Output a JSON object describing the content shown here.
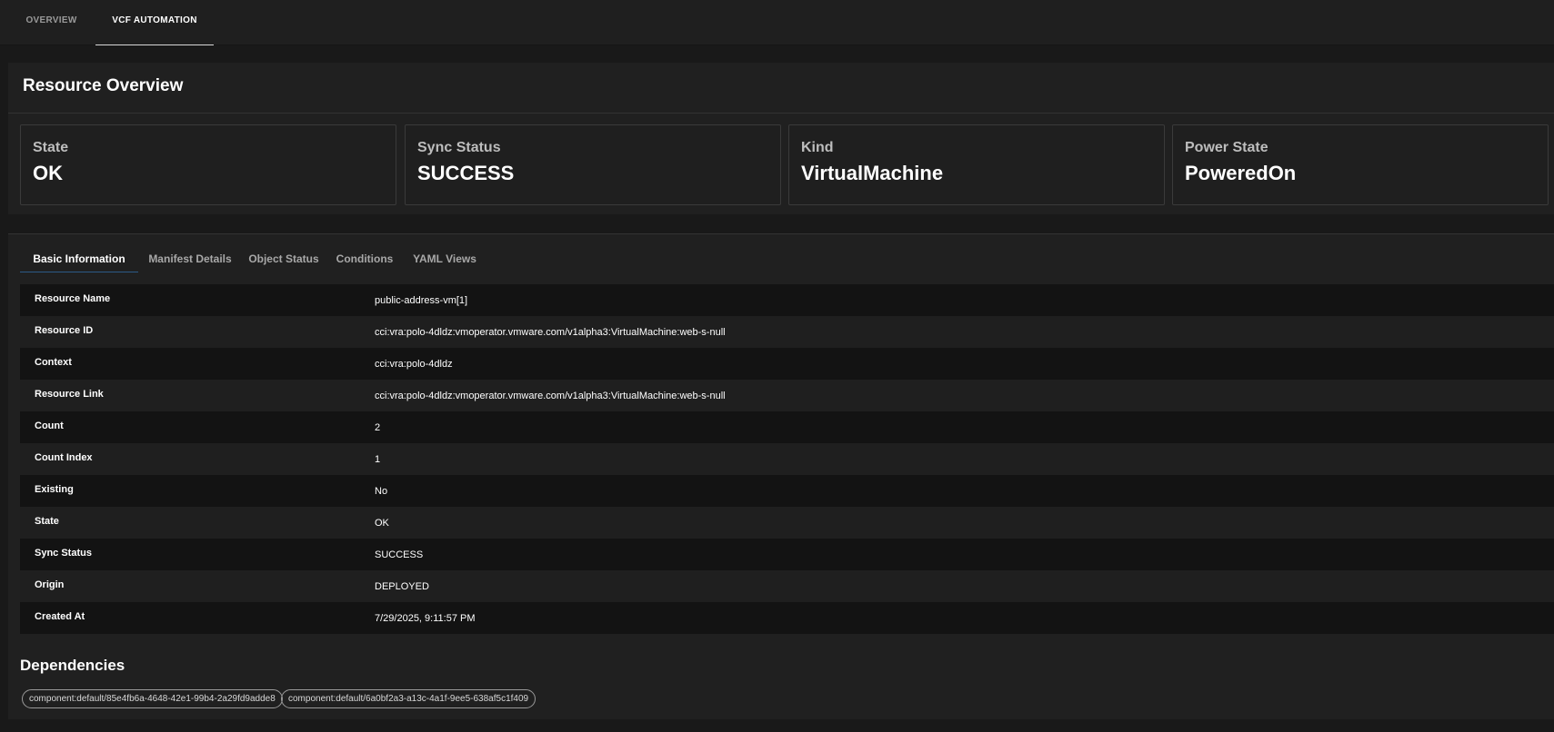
{
  "top_tabs": [
    {
      "label": "OVERVIEW",
      "active": false
    },
    {
      "label": "VCF AUTOMATION",
      "active": true
    }
  ],
  "overview": {
    "title": "Resource Overview",
    "cards": [
      {
        "label": "State",
        "value": "OK"
      },
      {
        "label": "Sync Status",
        "value": "SUCCESS"
      },
      {
        "label": "Kind",
        "value": "VirtualMachine"
      },
      {
        "label": "Power State",
        "value": "PoweredOn"
      }
    ]
  },
  "details": {
    "tabs": [
      {
        "label": "Basic Information",
        "active": true
      },
      {
        "label": "Manifest Details",
        "active": false
      },
      {
        "label": "Object Status",
        "active": false
      },
      {
        "label": "Conditions",
        "active": false
      },
      {
        "label": "YAML Views",
        "active": false
      }
    ],
    "rows": [
      {
        "key": "Resource Name",
        "value": "public-address-vm[1]"
      },
      {
        "key": "Resource ID",
        "value": "cci:vra:polo-4dldz:vmoperator.vmware.com/v1alpha3:VirtualMachine:web-s-null"
      },
      {
        "key": "Context",
        "value": "cci:vra:polo-4dldz"
      },
      {
        "key": "Resource Link",
        "value": "cci:vra:polo-4dldz:vmoperator.vmware.com/v1alpha3:VirtualMachine:web-s-null"
      },
      {
        "key": "Count",
        "value": "2"
      },
      {
        "key": "Count Index",
        "value": "1"
      },
      {
        "key": "Existing",
        "value": "No"
      },
      {
        "key": "State",
        "value": "OK"
      },
      {
        "key": "Sync Status",
        "value": "SUCCESS"
      },
      {
        "key": "Origin",
        "value": "DEPLOYED"
      },
      {
        "key": "Created At",
        "value": "7/29/2025, 9:11:57 PM"
      }
    ],
    "dependencies_title": "Dependencies",
    "dependencies": [
      "component:default/85e4fb6a-4648-42e1-99b4-2a29fd9adde8",
      "component:default/6a0bf2a3-a13c-4a1f-9ee5-638af5c1f409"
    ]
  }
}
